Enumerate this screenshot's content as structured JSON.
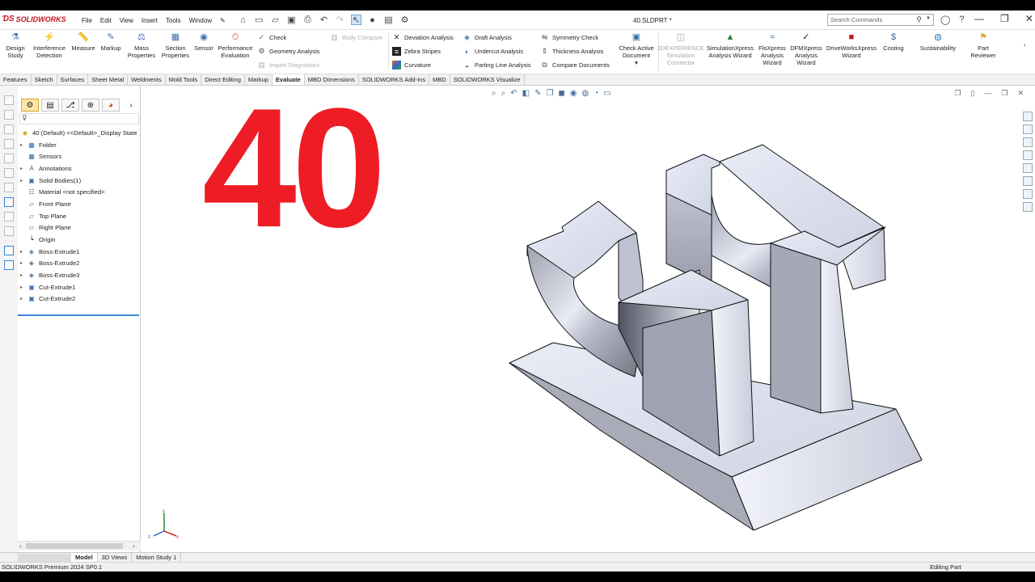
{
  "app": {
    "brand": "SOLIDWORKS",
    "document_title": "40.SLDPRT *"
  },
  "menu": [
    "File",
    "Edit",
    "View",
    "Insert",
    "Tools",
    "Window"
  ],
  "search": {
    "placeholder": "Search Commands"
  },
  "command_manager": {
    "design_study": "Design Study",
    "interference": "Interference Detection",
    "measure": "Measure",
    "markup": "Markup",
    "mass_properties": "Mass Properties",
    "section_properties": "Section Properties",
    "sensor": "Sensor",
    "performance": "Performance Evaluation",
    "check": "Check",
    "geometry_analysis": "Geometry Analysis",
    "import_diagnostics": "Import Diagnostics",
    "body_compare": "Body Compare",
    "deviation_analysis": "Deviation Analysis",
    "zebra_stripes": "Zebra Stripes",
    "curvature": "Curvature",
    "draft_analysis": "Draft Analysis",
    "undercut_analysis": "Undercut Analysis",
    "parting_line": "Parting Line Analysis",
    "symmetry_check": "Symmetry Check",
    "thickness_analysis": "Thickness Analysis",
    "compare_documents": "Compare Documents",
    "check_active": "Check Active Document",
    "experience": "3DEXPERIENCE Simulation Connector",
    "simulationxpress": "SimulationXpress Analysis Wizard",
    "floxpress": "FloXpress Analysis Wizard",
    "dfmxpress": "DFMXpress Analysis Wizard",
    "driveworks": "DriveWorksXpress Wizard",
    "costing": "Costing",
    "sustainability": "Sustainability",
    "part_reviewer": "Part Reviewer"
  },
  "tabs": [
    "Features",
    "Sketch",
    "Surfaces",
    "Sheet Metal",
    "Weldments",
    "Mold Tools",
    "Direct Editing",
    "Markup",
    "Evaluate",
    "MBD Dimensions",
    "SOLIDWORKS Add-Ins",
    "MBD",
    "SOLIDWORKS Visualize"
  ],
  "active_tab": "Evaluate",
  "feature_tree": {
    "root": "40 (Default) <<Default>_Display State",
    "items": [
      "Folder",
      "Sensors",
      "Annotations",
      "Solid Bodies(1)",
      "Material <not specified>",
      "Front Plane",
      "Top Plane",
      "Right Plane",
      "Origin",
      "Boss-Extrude1",
      "Boss-Extrude2",
      "Boss-Extrude3",
      "Cut-Extrude1",
      "Cut-Extrude2"
    ]
  },
  "viewport": {
    "big_label": "40",
    "big_label_color": "#ee1c25",
    "triad": {
      "x": "x",
      "y": "y",
      "z": "z"
    }
  },
  "bottom_tabs": [
    "Model",
    "3D Views",
    "Motion Study 1"
  ],
  "status": {
    "left": "SOLIDWORKS Premium 2024 SP0.1",
    "right": "Editing Part"
  }
}
